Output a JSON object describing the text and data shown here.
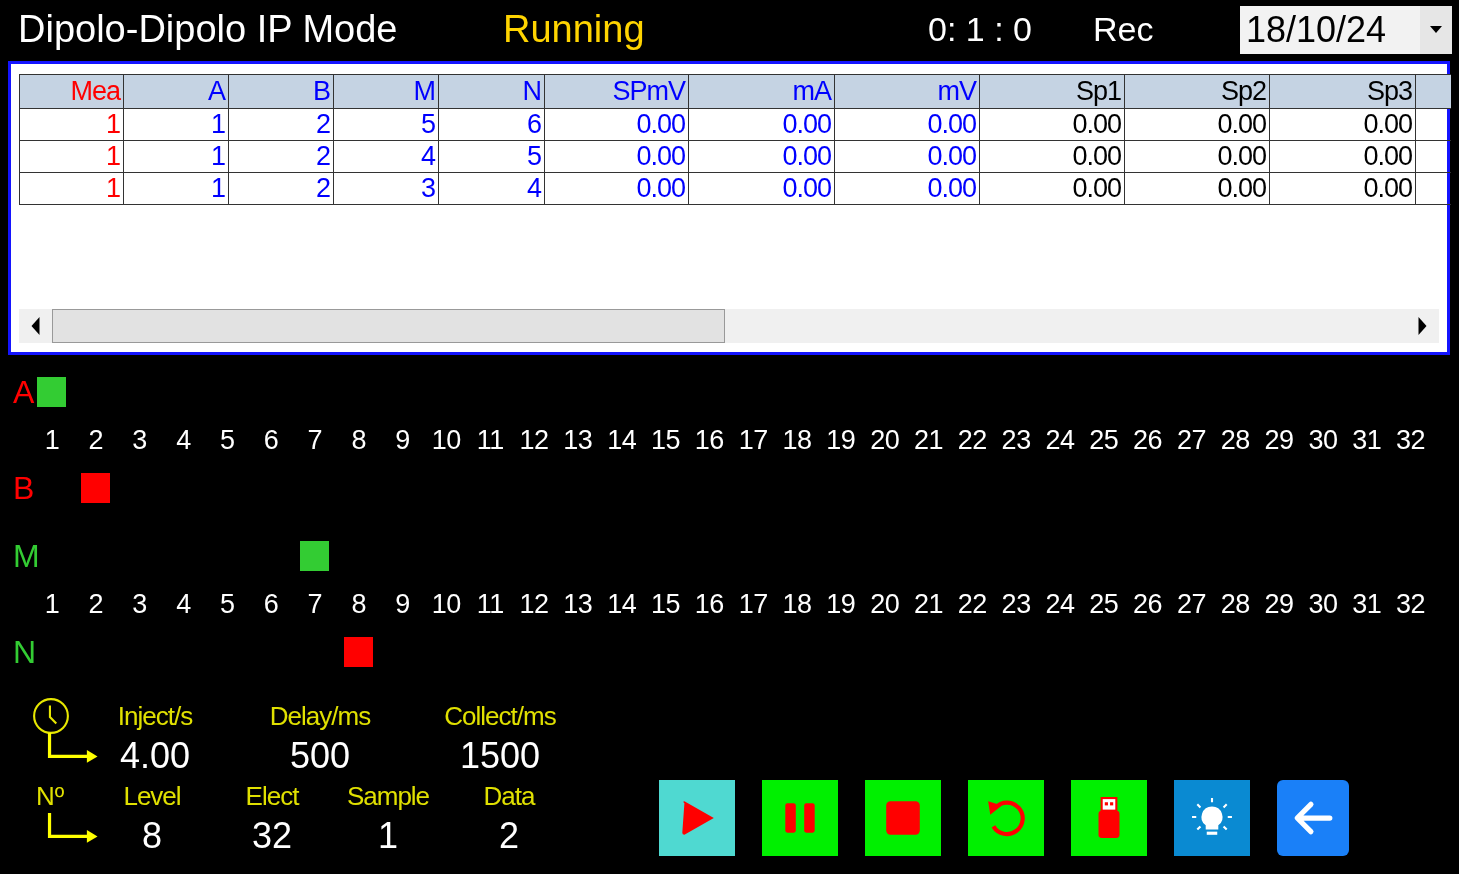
{
  "header": {
    "title": "Dipolo-Dipolo IP Mode",
    "status": "Running",
    "timer": "0: 1 : 0",
    "record": "Rec",
    "date": "18/10/24"
  },
  "table": {
    "columns": [
      {
        "label": "Mea",
        "color": "#ff0000"
      },
      {
        "label": "A",
        "color": "#0000ff"
      },
      {
        "label": "B",
        "color": "#0000ff"
      },
      {
        "label": "M",
        "color": "#0000ff"
      },
      {
        "label": "N",
        "color": "#0000ff"
      },
      {
        "label": "SPmV",
        "color": "#0000ff"
      },
      {
        "label": "mA",
        "color": "#0000ff"
      },
      {
        "label": "mV",
        "color": "#0000ff"
      },
      {
        "label": "Sp1",
        "color": "#000000"
      },
      {
        "label": "Sp2",
        "color": "#000000"
      },
      {
        "label": "Sp3",
        "color": "#000000"
      }
    ],
    "rows": [
      [
        "1",
        "1",
        "2",
        "5",
        "6",
        "0.00",
        "0.00",
        "0.00",
        "0.00",
        "0.00",
        "0.00"
      ],
      [
        "1",
        "1",
        "2",
        "4",
        "5",
        "0.00",
        "0.00",
        "0.00",
        "0.00",
        "0.00",
        "0.00"
      ],
      [
        "1",
        "1",
        "2",
        "3",
        "4",
        "0.00",
        "0.00",
        "0.00",
        "0.00",
        "0.00",
        "0.00"
      ]
    ]
  },
  "electrodes": [
    {
      "upper": {
        "label": {
          "text": "A",
          "color": "#ff0000"
        },
        "marker": {
          "color": "#33cc33"
        },
        "slots": [
          true,
          false,
          false,
          false,
          false,
          false,
          false,
          false,
          false,
          false,
          false,
          false,
          false,
          false,
          false,
          false,
          false,
          false,
          false,
          false,
          false,
          false,
          false,
          false,
          false,
          false,
          false,
          false,
          false,
          false,
          false,
          false
        ]
      },
      "numbers": [
        "1",
        "2",
        "3",
        "4",
        "5",
        "6",
        "7",
        "8",
        "9",
        "10",
        "11",
        "12",
        "13",
        "14",
        "15",
        "16",
        "17",
        "18",
        "19",
        "20",
        "21",
        "22",
        "23",
        "24",
        "25",
        "26",
        "27",
        "28",
        "29",
        "30",
        "31",
        "32"
      ],
      "lower": {
        "label": {
          "text": "B",
          "color": "#ff0000"
        },
        "marker": {
          "color": "#ff0000"
        },
        "slots": [
          false,
          true,
          false,
          false,
          false,
          false,
          false,
          false,
          false,
          false,
          false,
          false,
          false,
          false,
          false,
          false,
          false,
          false,
          false,
          false,
          false,
          false,
          false,
          false,
          false,
          false,
          false,
          false,
          false,
          false,
          false,
          false
        ]
      }
    },
    {
      "upper": {
        "label": {
          "text": "M",
          "color": "#33cc33"
        },
        "marker": {
          "color": "#33cc33"
        },
        "slots": [
          false,
          false,
          false,
          false,
          false,
          false,
          true,
          false,
          false,
          false,
          false,
          false,
          false,
          false,
          false,
          false,
          false,
          false,
          false,
          false,
          false,
          false,
          false,
          false,
          false,
          false,
          false,
          false,
          false,
          false,
          false,
          false
        ]
      },
      "numbers": [
        "1",
        "2",
        "3",
        "4",
        "5",
        "6",
        "7",
        "8",
        "9",
        "10",
        "11",
        "12",
        "13",
        "14",
        "15",
        "16",
        "17",
        "18",
        "19",
        "20",
        "21",
        "22",
        "23",
        "24",
        "25",
        "26",
        "27",
        "28",
        "29",
        "30",
        "31",
        "32"
      ],
      "lower": {
        "label": {
          "text": "N",
          "color": "#33cc33"
        },
        "marker": {
          "color": "#ff0000"
        },
        "slots": [
          false,
          false,
          false,
          false,
          false,
          false,
          false,
          true,
          false,
          false,
          false,
          false,
          false,
          false,
          false,
          false,
          false,
          false,
          false,
          false,
          false,
          false,
          false,
          false,
          false,
          false,
          false,
          false,
          false,
          false,
          false,
          false
        ]
      }
    }
  ],
  "timing": {
    "fields": [
      {
        "label": "Inject/s",
        "value": "4.00"
      },
      {
        "label": "Delay/ms",
        "value": "500"
      },
      {
        "label": "Collect/ms",
        "value": "1500"
      }
    ]
  },
  "counts": {
    "heading": "Nº",
    "fields": [
      {
        "label": "Level",
        "value": "8"
      },
      {
        "label": "Elect",
        "value": "32"
      },
      {
        "label": "Sample",
        "value": "1"
      },
      {
        "label": "Data",
        "value": "2"
      }
    ]
  },
  "buttons": [
    {
      "kind": "play"
    },
    {
      "kind": "pause"
    },
    {
      "kind": "stop"
    },
    {
      "kind": "reset"
    },
    {
      "kind": "usb"
    },
    {
      "kind": "light"
    },
    {
      "kind": "back"
    }
  ]
}
